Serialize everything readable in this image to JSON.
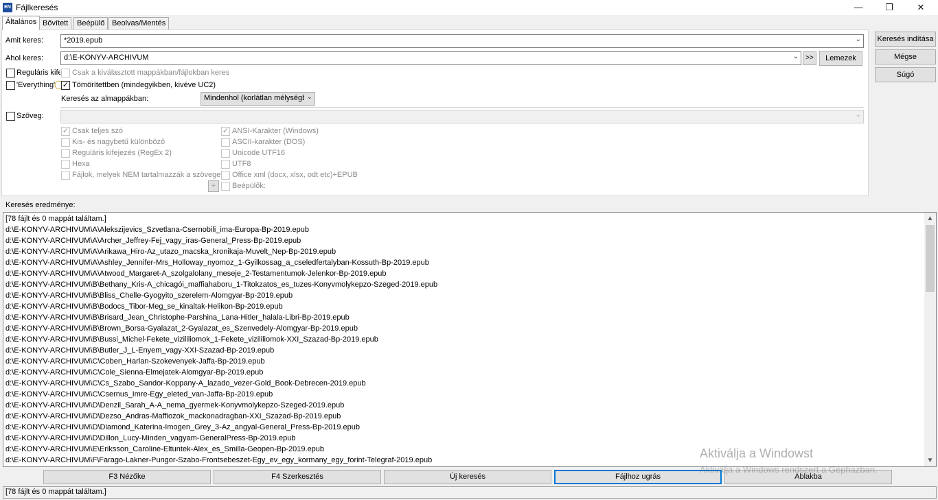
{
  "window": {
    "app_icon_text": "EN",
    "title": "Fájlkeresés",
    "minimize": "—",
    "restore": "❐",
    "close": "✕"
  },
  "tabs": [
    "Általános",
    "Bővített",
    "Beépülő",
    "Beolvas/Mentés"
  ],
  "search": {
    "what_label": "Amit keres:",
    "what_value": "*2019.epub",
    "where_label": "Ahol keres:",
    "where_value": "d:\\E-KONYV-ARCHIVUM",
    "arrows_button": ">>",
    "drives_button": "Lemezek",
    "regex_label": "Reguláris kife",
    "regex_checked": false,
    "selected_only_label": "Csak a kiválasztott mappákban/fájlokban keres",
    "selected_only_checked": false,
    "everything_label": "'Everything'",
    "everything_checked": false,
    "archives_label": "Tömörítettben (mindegyikben, kivéve UC2)",
    "archives_checked": true,
    "subdirs_label": "Keresés az almappákban:",
    "subdirs_value": "Mindenhol (korlátlan mélységbe"
  },
  "text_search": {
    "label": "Szöveg:",
    "checked": false,
    "value": "",
    "whole_words": "Csak teljes szó",
    "case_sensitive": "Kis- és nagybetű különböző",
    "regex2": "Reguláris kifejezés (RegEx 2)",
    "hex": "Hexa",
    "not_containing": "Fájlok, melyek NEM tartalmazzák a szöveget",
    "ansi": "ANSI-Karakter (Windows)",
    "ascii": "ASCII-karakter (DOS)",
    "utf16": "Unicode UTF16",
    "utf8": "UTF8",
    "office": "Office xml (docx, xlsx, odt etc)+EPUB",
    "plugins": "Beépülők:",
    "plus": "+"
  },
  "side_buttons": {
    "start": "Keresés indítása",
    "cancel": "Mégse",
    "help": "Súgó"
  },
  "results": {
    "label": "Keresés eredménye:",
    "rows": [
      " [78 fájlt és 0 mappát találtam.]",
      "d:\\E-KONYV-ARCHIVUM\\A\\Alekszijevics_Szvetlana-Csernobili_ima-Europa-Bp-2019.epub",
      "d:\\E-KONYV-ARCHIVUM\\A\\Archer_Jeffrey-Fej_vagy_iras-General_Press-Bp-2019.epub",
      "d:\\E-KONYV-ARCHIVUM\\A\\Arikawa_Hiro-Az_utazo_macska_kronikaja-Muvelt_Nep-Bp-2019.epub",
      "d:\\E-KONYV-ARCHIVUM\\A\\Ashley_Jennifer-Mrs_Holloway_nyomoz_1-Gyilkossag_a_cseledfertalyban-Kossuth-Bp-2019.epub",
      "d:\\E-KONYV-ARCHIVUM\\A\\Atwood_Margaret-A_szolgalolany_meseje_2-Testamentumok-Jelenkor-Bp-2019.epub",
      "d:\\E-KONYV-ARCHIVUM\\B\\Bethany_Kris-A_chicagói_maffiahaboru_1-Titokzatos_es_tuzes-Konyvmolykepzo-Szeged-2019.epub",
      "d:\\E-KONYV-ARCHIVUM\\B\\Bliss_Chelle-Gyogyito_szerelem-Alomgyar-Bp-2019.epub",
      "d:\\E-KONYV-ARCHIVUM\\B\\Bodocs_Tibor-Meg_se_kinaltak-Helikon-Bp-2019.epub",
      "d:\\E-KONYV-ARCHIVUM\\B\\Brisard_Jean_Christophe-Parshina_Lana-Hitler_halala-Libri-Bp-2019.epub",
      "d:\\E-KONYV-ARCHIVUM\\B\\Brown_Borsa-Gyalazat_2-Gyalazat_es_Szenvedely-Alomgyar-Bp-2019.epub",
      "d:\\E-KONYV-ARCHIVUM\\B\\Bussi_Michel-Fekete_vizililiomok_1-Fekete_vizililiomok-XXI_Szazad-Bp-2019.epub",
      "d:\\E-KONYV-ARCHIVUM\\B\\Butler_J_L-Enyem_vagy-XXI-Szazad-Bp-2019.epub",
      "d:\\E-KONYV-ARCHIVUM\\C\\Coben_Harlan-Szokevenyek-Jaffa-Bp-2019.epub",
      "d:\\E-KONYV-ARCHIVUM\\C\\Cole_Sienna-Elmejatek-Alomgyar-Bp-2019.epub",
      "d:\\E-KONYV-ARCHIVUM\\C\\Cs_Szabo_Sandor-Koppany-A_lazado_vezer-Gold_Book-Debrecen-2019.epub",
      "d:\\E-KONYV-ARCHIVUM\\C\\Csernus_Imre-Egy_eleted_van-Jaffa-Bp-2019.epub",
      "d:\\E-KONYV-ARCHIVUM\\D\\Denzil_Sarah_A-A_nema_gyermek-Konyvmolykepzo-Szeged-2019.epub",
      "d:\\E-KONYV-ARCHIVUM\\D\\Dezso_Andras-Maffiozok_mackonadragban-XXI_Szazad-Bp-2019.epub",
      "d:\\E-KONYV-ARCHIVUM\\D\\Diamond_Katerina-Imogen_Grey_3-Az_angyal-General_Press-Bp-2019.epub",
      "d:\\E-KONYV-ARCHIVUM\\D\\Dillon_Lucy-Minden_vagyam-GeneralPress-Bp-2019.epub",
      "d:\\E-KONYV-ARCHIVUM\\E\\Eriksson_Caroline-Eltuntek-Alex_es_Smilla-Geopen-Bp-2019.epub",
      "d:\\E-KONYV-ARCHIVUM\\F\\Farago-Lakner-Pungor-Szabo-Frontsebeszet-Egy_ev_egy_kormany_egy_forint-Telegraf-2019.epub"
    ]
  },
  "bottom_buttons": [
    "F3 Nézőke",
    "F4 Szerkesztés",
    "Új keresés",
    "Fájlhoz ugrás",
    "Ablakba"
  ],
  "status": "[78 fájlt és 0 mappát találtam.]",
  "watermark": {
    "line1": "Aktiválja a Windowst",
    "line2": "Aktiválja a Windows rendszert a Gépházban."
  },
  "icons": {
    "combo_arrow": "chevron-down-icon",
    "scroll_up": "▲",
    "scroll_down": "▼"
  },
  "colors": {
    "focus_border": "#0078d7",
    "title_icon_bg": "#1f4e9c"
  }
}
